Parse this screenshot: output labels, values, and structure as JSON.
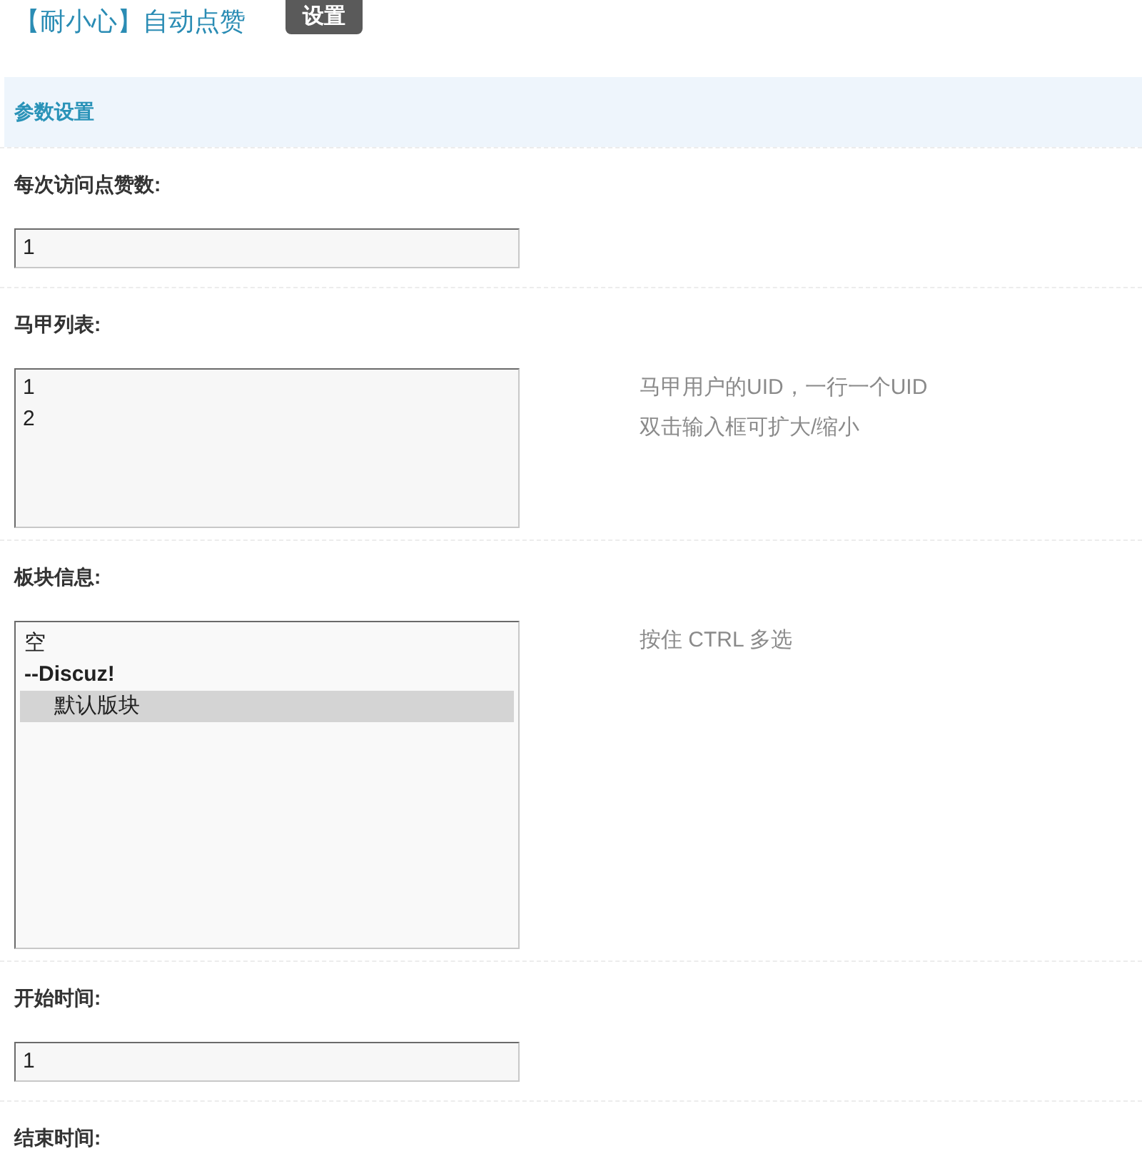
{
  "header": {
    "title": "【耐小心】自动点赞",
    "tabs": [
      {
        "label": "设置",
        "selected": true
      }
    ]
  },
  "section": {
    "title": "参数设置"
  },
  "fields": [
    {
      "label": "每次访问点赞数:",
      "kind": "text",
      "value": "1"
    },
    {
      "label": "马甲列表:",
      "kind": "textarea",
      "value": "1\n2",
      "hint": "马甲用户的UID，一行一个UID\n双击输入框可扩大/缩小"
    },
    {
      "label": "板块信息:",
      "kind": "select",
      "options": [
        {
          "label": "空",
          "kind": "option",
          "selected": false
        },
        {
          "label": "--Discuz!",
          "kind": "group",
          "children": [
            {
              "label": "默认版块",
              "kind": "option",
              "selected": true
            }
          ]
        }
      ],
      "hint": "按住 CTRL 多选"
    },
    {
      "label": "开始时间:",
      "kind": "text",
      "value": "1"
    },
    {
      "label": "结束时间:"
    }
  ]
}
